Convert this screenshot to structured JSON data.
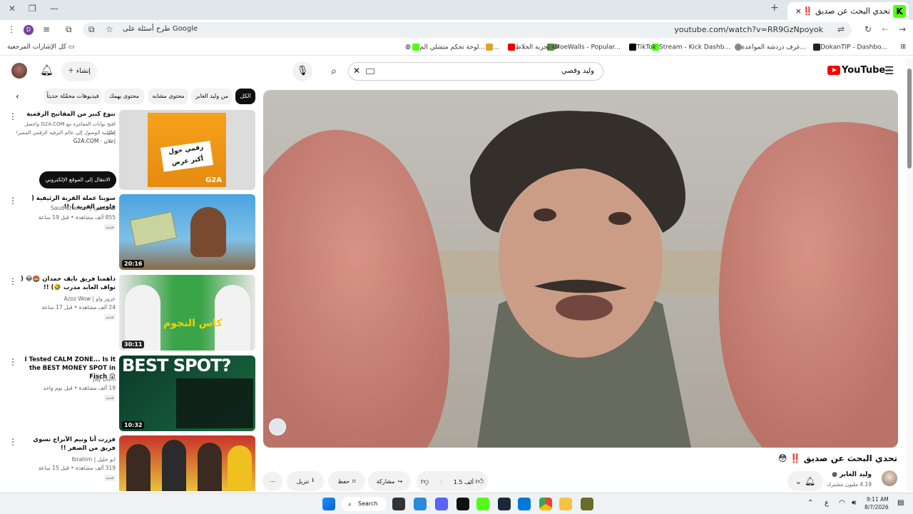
{
  "browser": {
    "tab_title": "تحدي البحث عن صديق ‼️ 😳 - YouTube",
    "url": "youtube.com/watch?v=RR9GzNpoyok",
    "google_chip": "طرح أسئلة على Google",
    "profile_letter": "D",
    "new_tab": "+",
    "close_tab": "×",
    "bookmarks": [
      "DokanTIP - Dashbo...",
      "غرف دردشة المواعدة...",
      "Stream - Kick Dashb...",
      "TikTok",
      "MoeWalls - Popular...",
      "تجربة الخلاط 😂",
      "...",
      "لوحة تحكم متشلي الم..."
    ],
    "all_bookmarks": "كل الإشارات المرجعية"
  },
  "youtube": {
    "logo_text": "YouTube",
    "logo_sup": "JO",
    "search_value": "وليد وقصي",
    "create_label": "إنشاء"
  },
  "chips": [
    "الكل",
    "من وليد الغابر",
    "محتوى مشابه",
    "محتوى يهمك",
    "فيديوهات محمّلة حديثاً"
  ],
  "recs": [
    {
      "title": "تنوع كبير من المفاتيح الرقمية",
      "line1": "افتح بوابات المغامرة مع G2A.COM واحصل على",
      "line2": "إمكانية الوصول إلى عالم الترفيه الرقمي المميز!",
      "ad": "إعلان · G2A.COM",
      "cta": "الانتقال إلى الموقع الإلكتروني",
      "thumb_text1": "رقمي حول",
      "thumb_text2": "أكبر عرض",
      "thumb_brand": "G2A"
    },
    {
      "title": "سويتا عملة القرية الرئيفية ( فلوس القرية ) !!",
      "channel": "قناة سعود | Saud Channel",
      "meta": "855 ألف مشاهدة • قبل 19 ساعة",
      "badge": "جديد",
      "duration": "20:16"
    },
    {
      "title": "داهمنا فريق نايف حمدان 🏟️😂 ( نواف العابد مدرب 🤣) !!",
      "channel": "عزوز واو | Azoz Wow",
      "meta": "24 ألف مشاهدة • قبل 17 ساعة",
      "badge": "جديد",
      "duration": "30:11",
      "thumb_text": "كاس النجوم"
    },
    {
      "title": "I Tested CALM ZONE... Is It the BEST MONEY SPOT in Fisch 😲",
      "channel": "Jay Dum",
      "meta": "19 ألف مشاهدة • قبل يوم واحد",
      "badge": "جديد",
      "duration": "10:32",
      "thumb_text": "BEST SPOT?"
    },
    {
      "title": "فزرت أنا وتيم الأبراج نسوي فريق من الصفر !!",
      "channel": "ابو خليل | Ibrahim",
      "meta": "319 ألف مشاهدة • قبل 15 ساعة",
      "badge": "جديد"
    }
  ],
  "video": {
    "title": "تحدي البحث عن صديق ‼️ 😳",
    "channel": "وليد الغابر",
    "subs": "4.19 مليون مشترك",
    "likes": "1.5 ألف",
    "share": "مشاركة",
    "save": "حفظ",
    "download": "تنزيل"
  },
  "taskbar": {
    "search": "Search",
    "time": "9:11 AM",
    "date": "8/7/2026",
    "lang": "ع"
  }
}
